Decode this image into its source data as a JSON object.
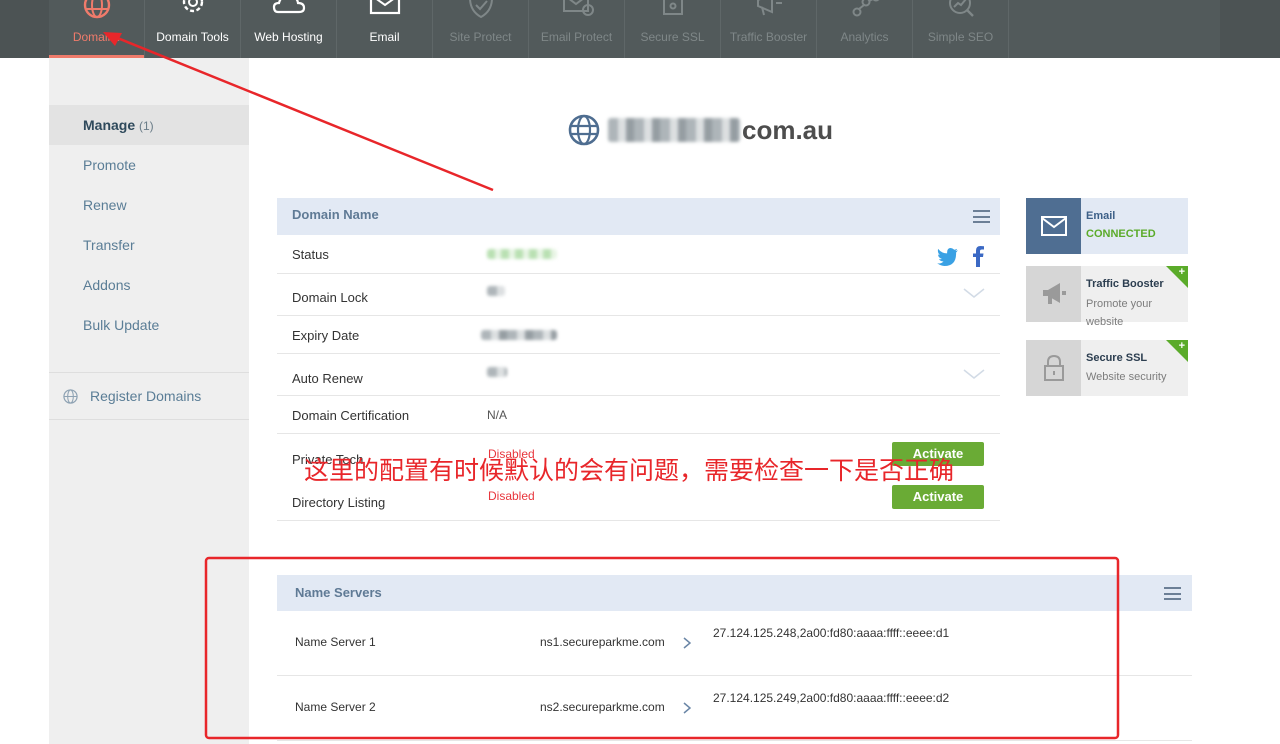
{
  "topnav": {
    "items": [
      {
        "label": "Domains",
        "icon": "globe-icon",
        "state": "active"
      },
      {
        "label": "Domain Tools",
        "icon": "gear-icon",
        "state": "normal"
      },
      {
        "label": "Web Hosting",
        "icon": "cloud-icon",
        "state": "normal"
      },
      {
        "label": "Email",
        "icon": "envelope-icon",
        "state": "normal"
      },
      {
        "label": "Site Protect",
        "icon": "shield-icon",
        "state": "disabled"
      },
      {
        "label": "Email Protect",
        "icon": "envelope-check-icon",
        "state": "disabled"
      },
      {
        "label": "Secure SSL",
        "icon": "lock-icon",
        "state": "disabled"
      },
      {
        "label": "Traffic Booster",
        "icon": "megaphone-icon",
        "state": "disabled"
      },
      {
        "label": "Analytics",
        "icon": "network-icon",
        "state": "disabled"
      },
      {
        "label": "Simple SEO",
        "icon": "magnifier-chart-icon",
        "state": "disabled"
      }
    ],
    "active_color": "#ef7b6b"
  },
  "sidebar": {
    "items": [
      {
        "label": "Manage",
        "count": "(1)"
      },
      {
        "label": "Promote"
      },
      {
        "label": "Renew"
      },
      {
        "label": "Transfer"
      },
      {
        "label": "Addons"
      },
      {
        "label": "Bulk Update"
      }
    ],
    "register_label": "Register Domains"
  },
  "domain": {
    "suffix": "com.au"
  },
  "domain_panel": {
    "title": "Domain Name",
    "rows": {
      "status": {
        "label": "Status"
      },
      "lock": {
        "label": "Domain Lock"
      },
      "expiry": {
        "label": "Expiry Date"
      },
      "autorenew": {
        "label": "Auto Renew"
      },
      "cert": {
        "label": "Domain Certification",
        "value": "N/A"
      },
      "private": {
        "label": "Private Tech",
        "value": "Disabled",
        "button": "Activate"
      },
      "directory": {
        "label": "Directory Listing",
        "value": "Disabled",
        "button": "Activate"
      }
    }
  },
  "widgets": {
    "email": {
      "title": "Email",
      "sub": "CONNECTED"
    },
    "traffic": {
      "title": "Traffic Booster",
      "sub": "Promote your website",
      "badge": "+"
    },
    "ssl": {
      "title": "Secure SSL",
      "sub": "Website security",
      "badge": "+"
    }
  },
  "name_servers": {
    "title": "Name Servers",
    "rows": [
      {
        "label": "Name Server 1",
        "host": "ns1.secureparkme.com",
        "ip": "27.124.125.248,2a00:fd80:aaaa:ffff::eeee:d1"
      },
      {
        "label": "Name Server 2",
        "host": "ns2.secureparkme.com",
        "ip": "27.124.125.249,2a00:fd80:aaaa:ffff::eeee:d2"
      }
    ]
  },
  "annotation": {
    "text": "这里的配置有时候默认的会有问题，需要检查一下是否正确",
    "color": "#e8262a"
  }
}
